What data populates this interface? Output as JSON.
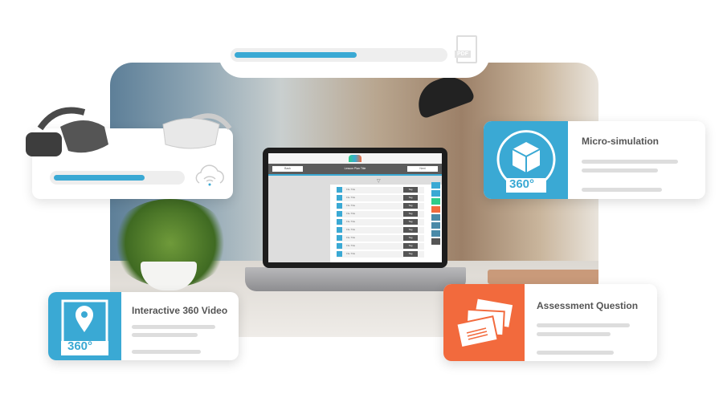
{
  "top_upload": {
    "progress_percent": 60,
    "file_icon": "pdf-file-icon",
    "file_label": "PDF"
  },
  "vr_card": {
    "progress_percent": 73,
    "icons": [
      "vr-headset-dark-icon",
      "vr-headset-white-icon",
      "cloud-wifi-icon"
    ]
  },
  "laptop": {
    "back": "Back",
    "title": "Lesson Plan Title",
    "next": "Next",
    "files": [
      {
        "name": "File Title",
        "tag": "Tag"
      },
      {
        "name": "File Title",
        "tag": "Tag"
      },
      {
        "name": "File Title",
        "tag": "Tag"
      },
      {
        "name": "File Title",
        "tag": "Tag"
      },
      {
        "name": "File Title",
        "tag": "Tag"
      },
      {
        "name": "File Title",
        "tag": "Tag"
      },
      {
        "name": "File Title",
        "tag": "Tag"
      },
      {
        "name": "File Title",
        "tag": "Tag"
      },
      {
        "name": "File Title",
        "tag": "Tag"
      }
    ],
    "side_colors": [
      "#3aa9d4",
      "#3aa9d4",
      "#2ecc8a",
      "#f26a3d",
      "#4a8aa8",
      "#4a8aa8",
      "#4a8aa8",
      "#555555"
    ]
  },
  "cards": {
    "micro": {
      "title": "Micro-simulation",
      "badge": "360°",
      "icon": "cube-360-icon",
      "color": "#3aa9d4"
    },
    "assessment": {
      "title": "Assessment Question",
      "icon": "cards-icon",
      "color": "#f26a3d"
    },
    "video": {
      "title": "Interactive 360 Video",
      "badge": "360°",
      "icon": "map-pin-360-icon",
      "color": "#3aa9d4"
    }
  }
}
